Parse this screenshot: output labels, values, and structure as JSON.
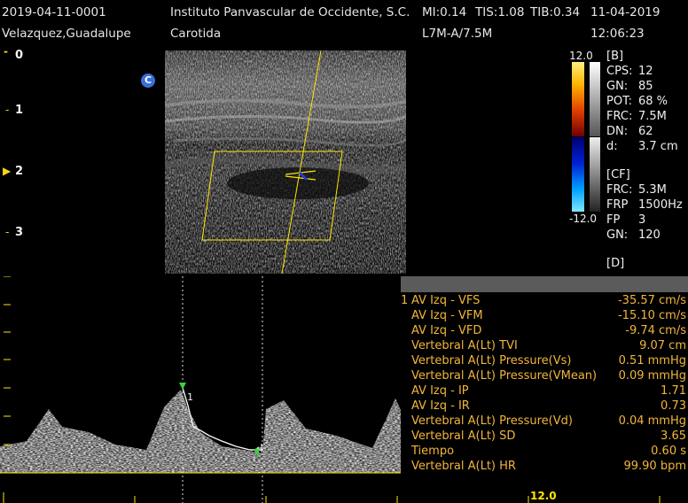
{
  "header": {
    "study_id": "2019-04-11-0001",
    "institution": "Instituto Panvascular de Occidente, S.C.",
    "mi": "MI:0.14",
    "tis": "TIS:1.08",
    "tib": "TIB:0.34",
    "date": "11-04-2019",
    "patient": "Velazquez,Guadalupe",
    "exam": "Carotida",
    "probe": "L7M-A/7.5M",
    "time": "12:06:23"
  },
  "depth_scale": {
    "marks": [
      "0",
      "1",
      "2",
      "3"
    ],
    "focus_marker": "▶"
  },
  "color_badge": "C",
  "colorbar": {
    "top_value": "12.0",
    "bottom_value": "-12.0"
  },
  "b_mode": {
    "title": "[B]",
    "params": [
      {
        "k": "CPS:",
        "v": "12"
      },
      {
        "k": "GN:",
        "v": "85"
      },
      {
        "k": "POT:",
        "v": "68 %"
      },
      {
        "k": "FRC:",
        "v": "7.5M"
      },
      {
        "k": "DN:",
        "v": "62"
      },
      {
        "k": "d:",
        "v": "3.7 cm"
      }
    ]
  },
  "cf_mode": {
    "title": "[CF]",
    "params": [
      {
        "k": "FRC:",
        "v": "5.3M"
      },
      {
        "k": "FRP",
        "v": "1500Hz"
      },
      {
        "k": "FP",
        "v": "3"
      },
      {
        "k": "GN:",
        "v": "120"
      }
    ]
  },
  "d_mode": {
    "title": "[D]"
  },
  "measurements": [
    {
      "n": "1",
      "k": "AV Izq - VFS",
      "v": "-35.57 cm/s"
    },
    {
      "n": "",
      "k": "AV Izq - VFM",
      "v": "-15.10 cm/s"
    },
    {
      "n": "",
      "k": "AV Izq - VFD",
      "v": "-9.74 cm/s"
    },
    {
      "n": "",
      "k": "Vertebral A(Lt) TVI",
      "v": "9.07 cm"
    },
    {
      "n": "",
      "k": "Vertebral A(Lt) Pressure(Vs)",
      "v": "0.51 mmHg"
    },
    {
      "n": "",
      "k": "Vertebral A(Lt) Pressure(VMean)",
      "v": "0.09 mmHg"
    },
    {
      "n": "",
      "k": "AV Izq - IP",
      "v": "1.71"
    },
    {
      "n": "",
      "k": "AV Izq - IR",
      "v": "0.73"
    },
    {
      "n": "",
      "k": "Vertebral A(Lt) Pressure(Vd)",
      "v": "0.04 mmHg"
    },
    {
      "n": "",
      "k": "Vertebral A(Lt) SD",
      "v": "3.65"
    },
    {
      "n": "",
      "k": "Tiempo",
      "v": "0.60 s"
    },
    {
      "n": "",
      "k": "Vertebral A(Lt) HR",
      "v": "99.90 bpm"
    }
  ],
  "doppler": {
    "cursor_label": "1",
    "scale_value": "12.0"
  }
}
